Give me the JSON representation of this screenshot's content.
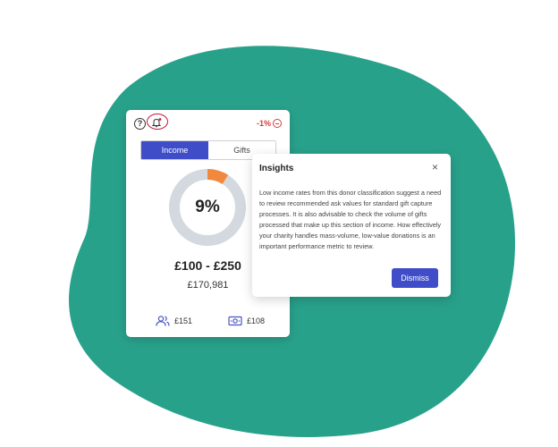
{
  "colors": {
    "background_blob": "#28a18b",
    "accent": "#3f4ec8",
    "donut_segment": "#f0883e",
    "donut_track": "#d3d9df",
    "negative": "#d63b3b",
    "alert_ring": "#c51b3c"
  },
  "card": {
    "icons": {
      "help": "help-icon",
      "bell": "bell-icon"
    },
    "help_glyph": "?",
    "change": "-1%",
    "tabs": [
      {
        "label": "Income",
        "active": true
      },
      {
        "label": "Gifts",
        "active": false
      }
    ],
    "percentage_value": 0.09,
    "percentage_label": "9%",
    "range": "£100 - £250",
    "amount": "£170,981",
    "stats": [
      {
        "icon": "people-icon",
        "value": "£151"
      },
      {
        "icon": "banknote-icon",
        "value": "£108"
      }
    ]
  },
  "insights": {
    "title": "Insights",
    "close_glyph": "×",
    "body": "Low income rates from this donor classification suggest a need to review recommended ask values for standard gift capture processes. It is also advisable to check the volume of gifts processed that make up this section of income. How effectively your charity handles mass-volume, low-value donations is an important performance metric to review.",
    "dismiss_label": "Dismiss"
  }
}
